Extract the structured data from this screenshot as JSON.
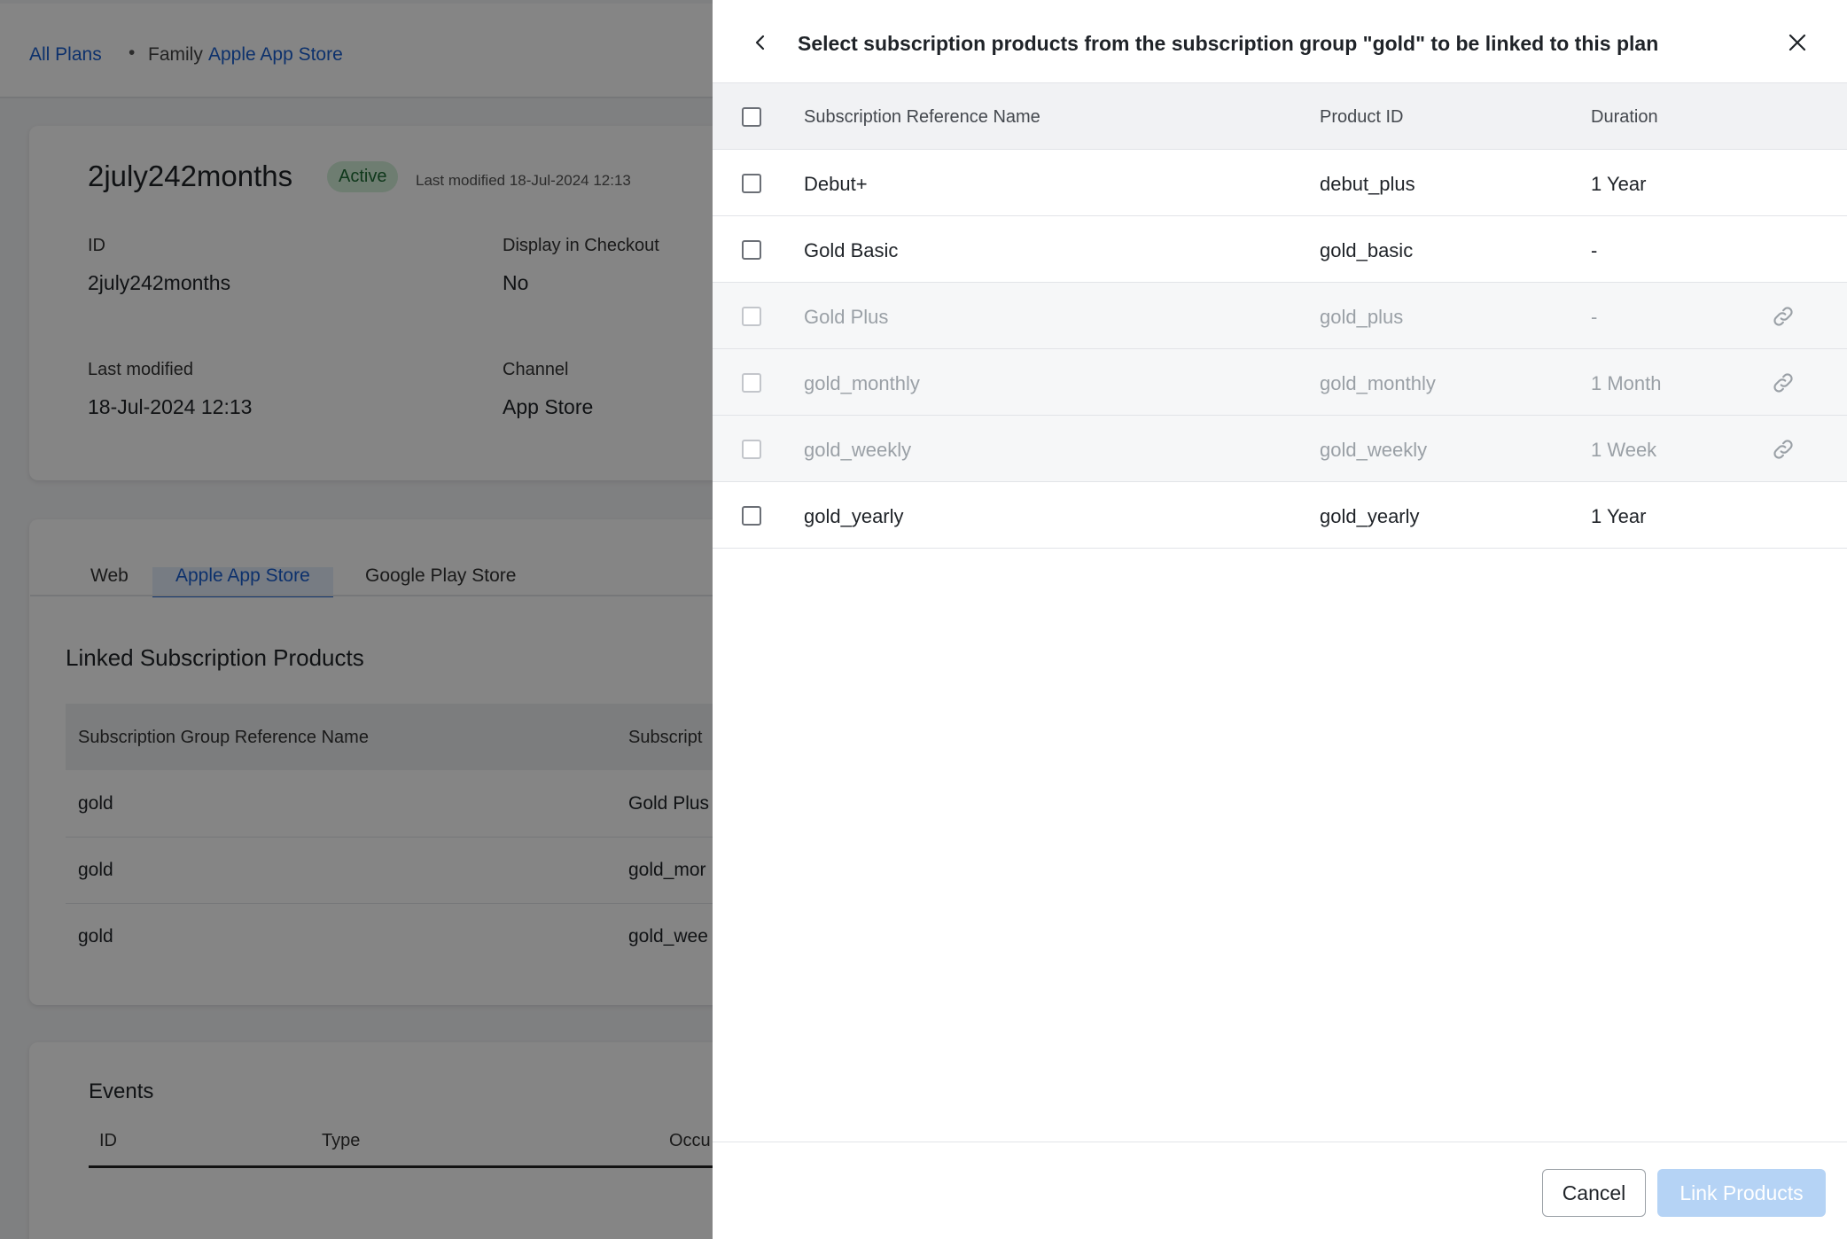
{
  "breadcrumb": {
    "all_plans": "All Plans",
    "family_label": "Family",
    "family_link": "Apple App Store"
  },
  "plan": {
    "title": "2july242months",
    "status": "Active",
    "last_modified_inline": "Last modified 18-Jul-2024 12:13",
    "fields": [
      {
        "label": "ID",
        "value": "2july242months"
      },
      {
        "label": "Display in Checkout",
        "value": "No"
      },
      {
        "label": "Last modified",
        "value": "18-Jul-2024 12:13"
      },
      {
        "label": "Channel",
        "value": "App Store"
      }
    ]
  },
  "tabs": [
    "Web",
    "Apple App Store",
    "Google Play Store"
  ],
  "linked": {
    "title": "Linked Subscription Products",
    "headers": [
      "Subscription Group Reference Name",
      "Subscript"
    ],
    "rows": [
      [
        "gold",
        "Gold Plus"
      ],
      [
        "gold",
        "gold_mor"
      ],
      [
        "gold",
        "gold_wee"
      ]
    ]
  },
  "events": {
    "title": "Events",
    "headers": [
      "ID",
      "Type",
      "Occu"
    ]
  },
  "drawer": {
    "title": "Select subscription products from the subscription group \"gold\" to be linked to this plan",
    "headers": {
      "name": "Subscription Reference Name",
      "product_id": "Product ID",
      "duration": "Duration"
    },
    "rows": [
      {
        "name": "Debut+",
        "product_id": "debut_plus",
        "duration": "1 Year",
        "linked": false
      },
      {
        "name": "Gold Basic",
        "product_id": "gold_basic",
        "duration": "-",
        "linked": false
      },
      {
        "name": "Gold Plus",
        "product_id": "gold_plus",
        "duration": "-",
        "linked": true
      },
      {
        "name": "gold_monthly",
        "product_id": "gold_monthly",
        "duration": "1 Month",
        "linked": true
      },
      {
        "name": "gold_weekly",
        "product_id": "gold_weekly",
        "duration": "1 Week",
        "linked": true
      },
      {
        "name": "gold_yearly",
        "product_id": "gold_yearly",
        "duration": "1 Year",
        "linked": false
      }
    ],
    "cancel_label": "Cancel",
    "link_label": "Link Products"
  },
  "colors": {
    "accent": "#1a5fd0",
    "active_badge": "#d3f0d9",
    "primary_disabled": "#b5d3f5"
  },
  "icons": {
    "back": "chevron-left-icon",
    "close": "close-icon",
    "linked": "link-icon"
  }
}
